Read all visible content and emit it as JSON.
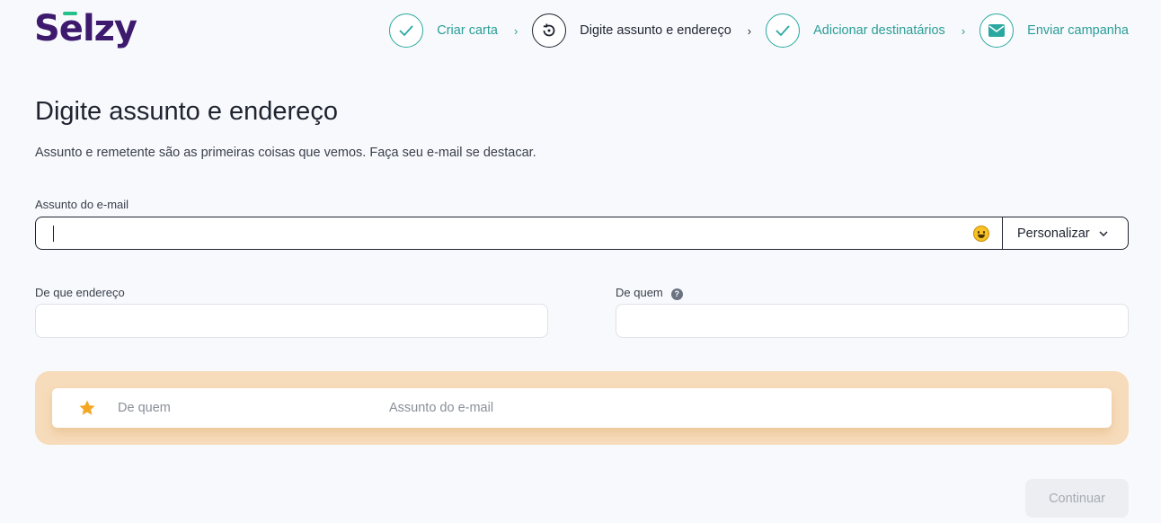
{
  "brand": {
    "name": "Selzy",
    "accent": "#24c18b",
    "color": "#3d1a6e"
  },
  "steps": [
    {
      "label": "Criar carta",
      "state": "done",
      "icon": "check-icon"
    },
    {
      "label": "Digite assunto e endereço",
      "state": "current",
      "icon": "refresh-icon"
    },
    {
      "label": "Adicionar destinatários",
      "state": "done",
      "icon": "check-icon"
    },
    {
      "label": "Enviar campanha",
      "state": "pending",
      "icon": "envelope-icon"
    }
  ],
  "step_separator": "›",
  "page": {
    "title": "Digite assunto e endereço",
    "subtitle": "Assunto e remetente são as primeiras coisas que vemos. Faça seu e-mail se destacar."
  },
  "subject": {
    "label": "Assunto do e-mail",
    "value": "",
    "personalize_label": "Personalizar"
  },
  "from_address": {
    "label": "De que endereço",
    "value": ""
  },
  "from_name": {
    "label": "De quem",
    "value": "",
    "help": "?"
  },
  "preview": {
    "from": "De quem",
    "subject": "Assunto do e-mail"
  },
  "continue_label": "Continuar",
  "colors": {
    "teal": "#2aa8a0",
    "preview_bg": "#f7dcbb",
    "star": "#f5a623"
  }
}
